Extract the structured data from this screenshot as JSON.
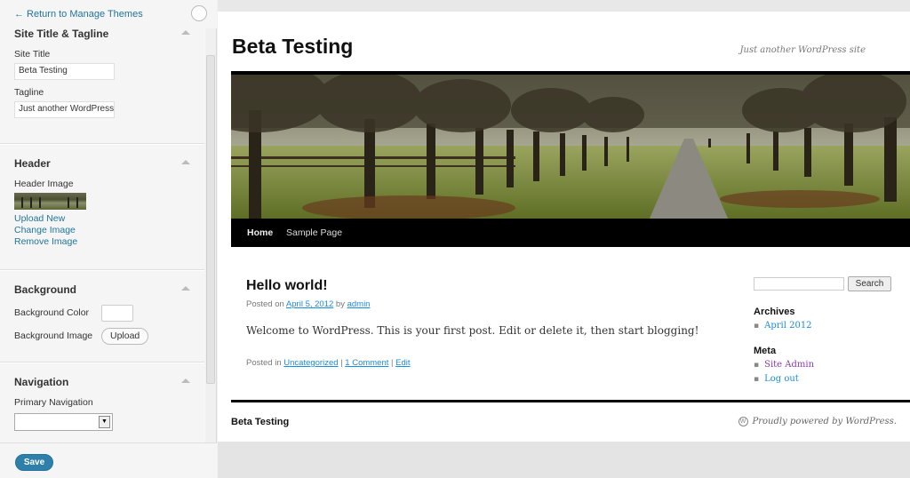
{
  "panel": {
    "back_link": "← Return to Manage Themes",
    "sections": {
      "site_title": {
        "title": "Site Title & Tagline",
        "site_title_label": "Site Title",
        "site_title_value": "Beta Testing",
        "tagline_label": "Tagline",
        "tagline_value": "Just another WordPress site"
      },
      "header": {
        "title": "Header",
        "image_label": "Header Image",
        "upload_new": "Upload New",
        "change_image": "Change Image",
        "remove_image": "Remove Image"
      },
      "background": {
        "title": "Background",
        "color_label": "Background Color",
        "image_label": "Background Image",
        "upload_button": "Upload"
      },
      "navigation": {
        "title": "Navigation",
        "primary_label": "Primary Navigation",
        "primary_value": ""
      }
    },
    "save_button": "Save"
  },
  "site": {
    "title": "Beta Testing",
    "description": "Just another WordPress site",
    "nav": [
      "Home",
      "Sample Page"
    ],
    "post": {
      "title": "Hello world!",
      "meta_prefix": "Posted on",
      "meta_date": "April 5, 2012",
      "meta_by": "by",
      "meta_author": "admin",
      "body": "Welcome to WordPress. This is your first post. Edit or delete it, then start blogging!",
      "footer_prefix": "Posted in",
      "category": "Uncategorized",
      "sep1": "|",
      "comments": "1 Comment",
      "sep2": "|",
      "edit": "Edit"
    },
    "search_button": "Search",
    "archives_title": "Archives",
    "archives": [
      "April 2012"
    ],
    "meta_title": "Meta",
    "meta_links": [
      "Site Admin",
      "Log out"
    ],
    "footer_title": "Beta Testing",
    "footer_power": "Proudly powered by WordPress."
  },
  "colors": {
    "link": "#21759b",
    "save_button": "#2e7fa9",
    "nav_bar": "#000000"
  }
}
